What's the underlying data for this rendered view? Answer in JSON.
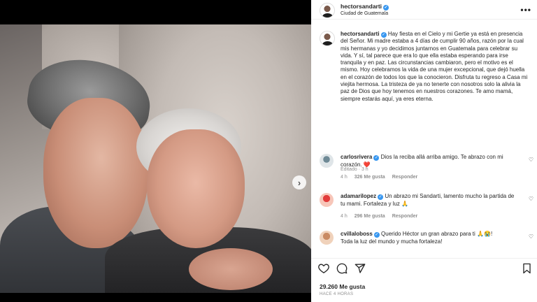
{
  "post": {
    "username": "hectorsandarti",
    "location": "Ciudad de Guatemala",
    "caption": "Hay fiesta en el Cielo y mi Gertie ya está en presencia del Señor. Mi madre estaba a 4 días de cumplir 90 años, razón por la cual mis hermanas y yo decidimos juntarnos en Guatemala para celebrar su vida. Y sí, tal parece que era lo que ella estaba esperando para irse tranquila y en paz. Las circunstancias cambiaron, pero el motivo es el mismo. Hoy celebramos la vida de una mujer excepcional, que dejó huella en el corazón de todos los que la conocieron. Disfruta tu regreso a Casa mi viejita hermosa. La tristeza de ya no tenerte con nosotros solo la alivia la paz de Dios que hoy tenemos en nuestros corazones. Te amo mamá, siempre estarás aquí, ya eres eterna.",
    "edited_label": "Editado · 3 h",
    "likes": "29.260 Me gusta",
    "time_ago": "HACE 4 HORAS",
    "carousel_count": 5,
    "carousel_active_index": 0
  },
  "comments": [
    {
      "username": "carlosrivera",
      "text": "Dios la reciba allá arriba amigo. Te abrazo con mi corazón.",
      "emoji": "❤️",
      "time": "4 h",
      "likes": "326 Me gusta",
      "reply": "Responder"
    },
    {
      "username": "adamarilopez",
      "text": "Un abrazo mi Sandarti, lamento mucho la partida de tu mami. Fortaleza y luz",
      "emoji": "🙏",
      "time": "4 h",
      "likes": "296 Me gusta",
      "reply": "Responder"
    },
    {
      "username": "cvillaloboss",
      "text": "Querido Héctor un gran abrazo para ti",
      "emoji": "🙏😭!",
      "text2": "Toda la luz del mundo y mucha fortaleza!"
    }
  ],
  "icons": {
    "more": "more-options-icon",
    "next": "chevron-right-icon",
    "like": "heart-icon",
    "comment": "comment-icon",
    "share": "send-icon",
    "save": "bookmark-icon",
    "verified": "verified-badge-icon"
  },
  "colors": {
    "verified": "#3897f0",
    "muted": "#8e8e8e",
    "text": "#262626"
  }
}
